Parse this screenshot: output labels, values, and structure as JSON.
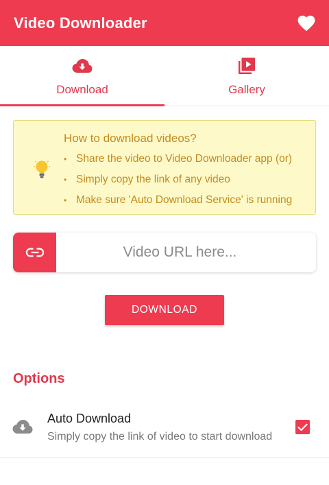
{
  "app": {
    "title": "Video Downloader",
    "accent_color": "#ee3b50",
    "favorite_icon": "heart-icon"
  },
  "tabs": [
    {
      "label": "Download",
      "icon": "cloud-download-icon",
      "active": true
    },
    {
      "label": "Gallery",
      "icon": "video-library-icon",
      "active": false
    }
  ],
  "info": {
    "icon": "lightbulb-icon",
    "title": "How to download videos?",
    "items": [
      "Share the video to Video Downloader app (or)",
      "Simply copy the link of any video",
      "Make sure 'Auto Download Service' is running"
    ],
    "bullet": "•"
  },
  "url_input": {
    "icon": "link-icon",
    "value": "",
    "placeholder": "Video URL here..."
  },
  "download_button": {
    "label": "DOWNLOAD"
  },
  "options": {
    "title": "Options",
    "items": [
      {
        "icon": "cloud-download-icon",
        "title": "Auto Download",
        "subtitle": "Simply copy the link of video to start download",
        "checked": true
      }
    ]
  }
}
